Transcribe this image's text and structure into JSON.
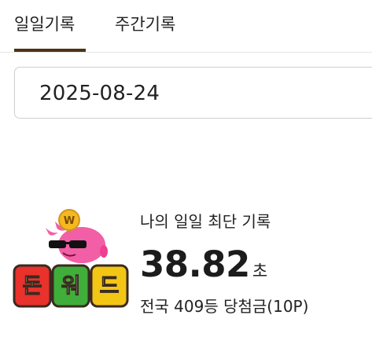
{
  "tabs": [
    {
      "label": "일일기록",
      "active": true
    },
    {
      "label": "주간기록",
      "active": false
    }
  ],
  "date_selector": {
    "value": "2025-08-24"
  },
  "logo": {
    "text": "돈워드",
    "coin_letter": "W"
  },
  "record": {
    "label": "나의 일일 최단 기록",
    "time_value": "38.82",
    "time_unit": "초",
    "rank_text": "전국 409등 당첨금(10P)"
  },
  "colors": {
    "active_tab_indicator": "#4a3516",
    "logo_pink": "#f25fa6",
    "logo_red_block": "#e8322b",
    "logo_green_block": "#3fae3a",
    "logo_yellow_block": "#f3c615",
    "coin_gold": "#f4b821"
  }
}
